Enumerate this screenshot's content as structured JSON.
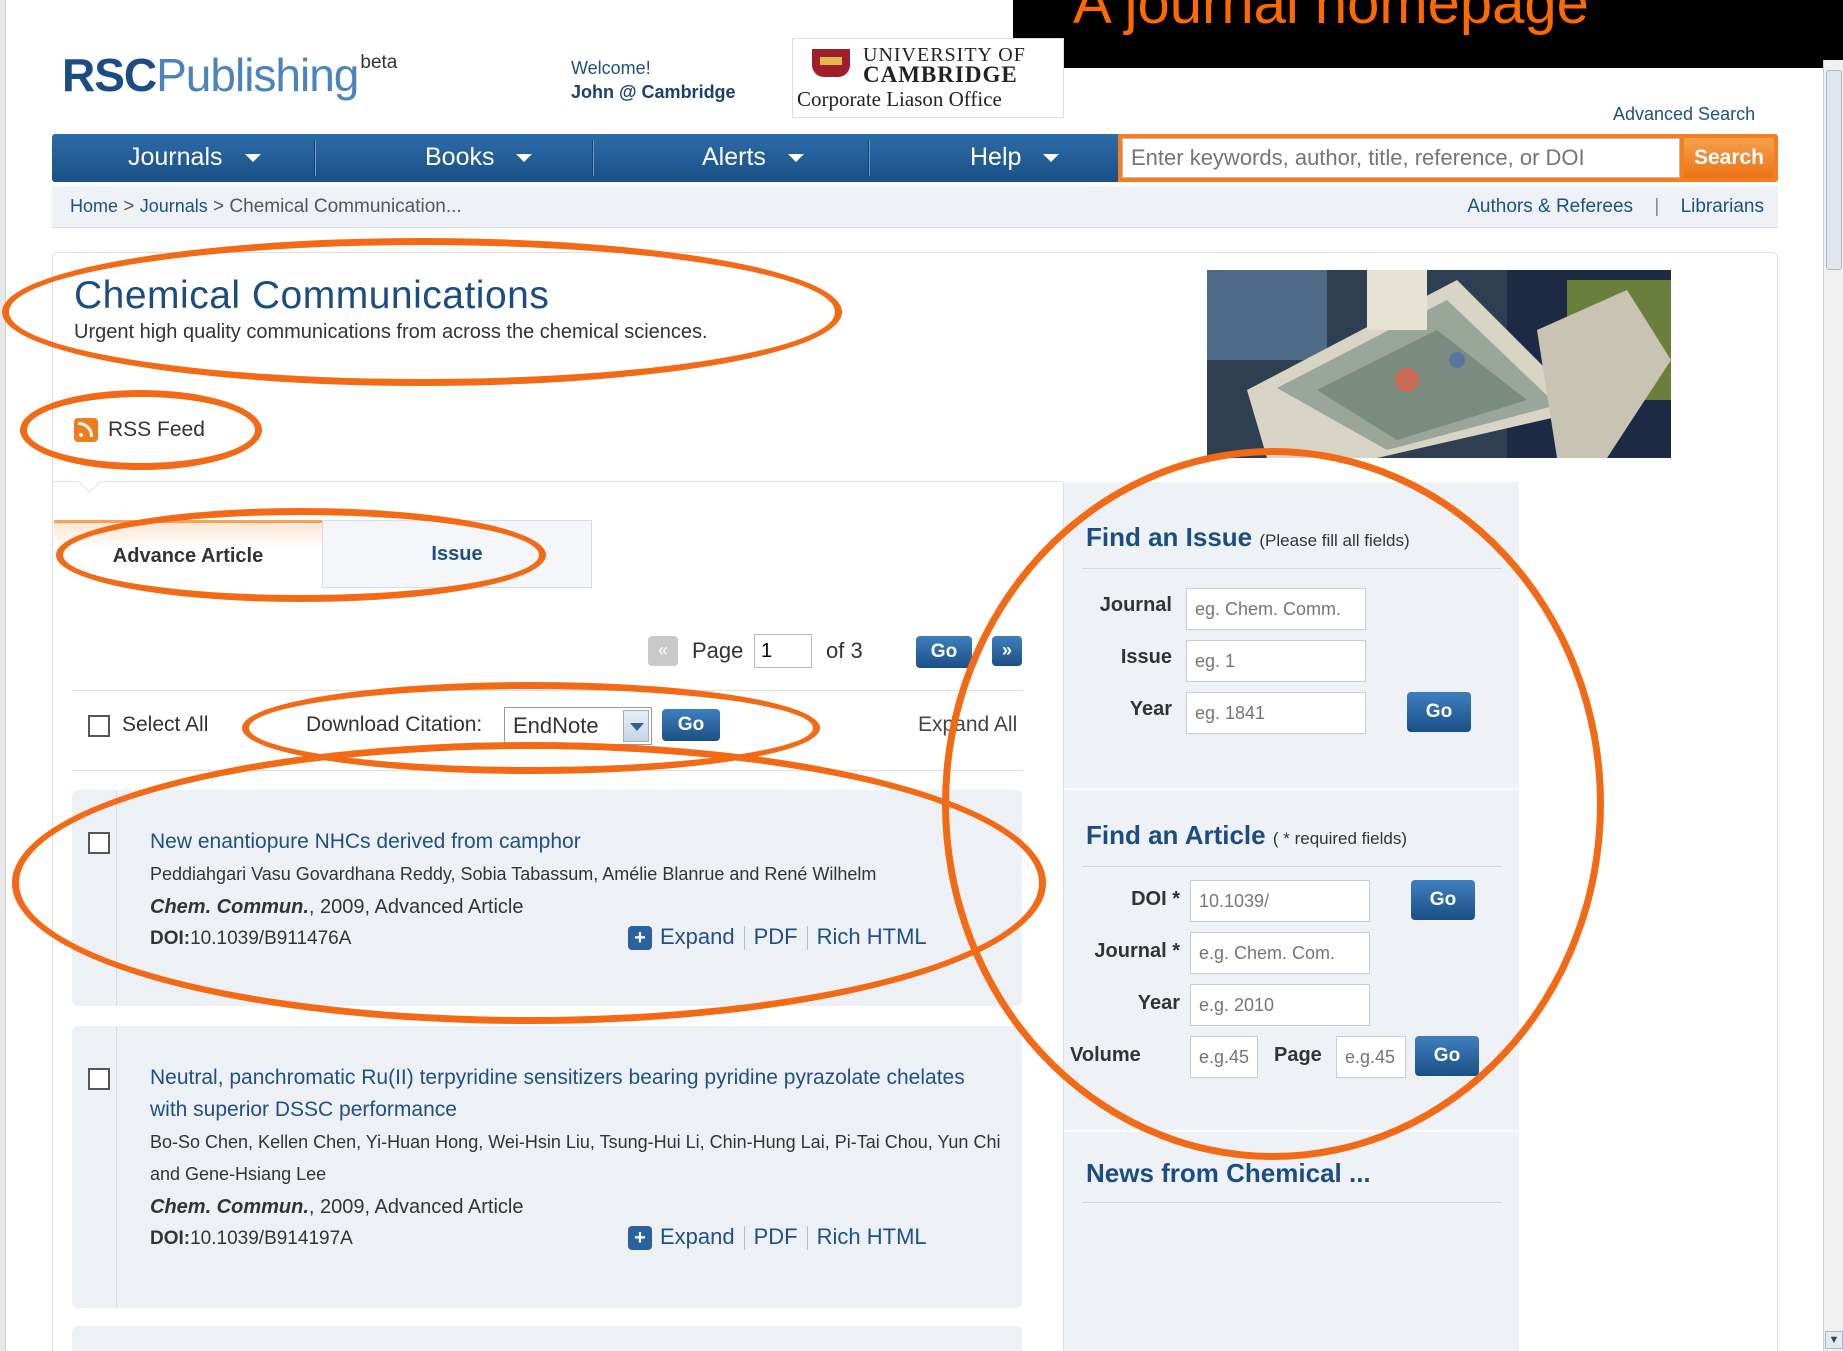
{
  "slide": {
    "title": "A journal homepage"
  },
  "header": {
    "logo_rsc": "RSC",
    "logo_publishing": "Publishing",
    "logo_beta": "beta",
    "welcome": "Welcome!",
    "user": "John @ Cambridge",
    "institution_line1": "UNIVERSITY OF",
    "institution_line2": "CAMBRIDGE",
    "institution_office": "Corporate Liason Office",
    "advanced_search": "Advanced Search"
  },
  "nav": {
    "items": [
      {
        "label": "Journals"
      },
      {
        "label": "Books"
      },
      {
        "label": "Alerts"
      },
      {
        "label": "Help"
      }
    ],
    "search_placeholder": "Enter keywords, author, title, reference, or DOI",
    "search_button": "Search"
  },
  "breadcrumb": {
    "home": "Home",
    "journals": "Journals",
    "current": "Chemical Communication...",
    "sep": ">",
    "authors_referees": "Authors & Referees",
    "separator": "|",
    "librarians": "Librarians"
  },
  "journal": {
    "title": "Chemical Communications",
    "subtitle": "Urgent high quality communications from across the chemical sciences.",
    "rss": "RSS Feed"
  },
  "tabs": {
    "advance_article": "Advance Article",
    "issue": "Issue"
  },
  "pager": {
    "prev": "«",
    "page_label": "Page",
    "page_value": "1",
    "of": "of 3",
    "go": "Go",
    "next": "»"
  },
  "toolbar": {
    "select_all": "Select All",
    "download_citation": "Download Citation:",
    "citation_format": "EndNote",
    "go": "Go",
    "expand_all": "Expand All"
  },
  "articles": [
    {
      "title": "New enantiopure NHCs derived from camphor",
      "authors": "Peddiahgari Vasu Govardhana Reddy, Sobia Tabassum, Amélie Blanrue and René Wilhelm",
      "journal": "Chem. Commun.",
      "cite_rest": ", 2009, Advanced Article",
      "doi_label": "DOI:",
      "doi": "10.1039/B911476A",
      "expand": "Expand",
      "pdf": "PDF",
      "html": "Rich HTML"
    },
    {
      "title": "Neutral, panchromatic Ru(II) terpyridine sensitizers bearing pyridine pyrazolate chelates with superior DSSC performance",
      "authors": "Bo-So Chen, Kellen Chen, Yi-Huan Hong, Wei-Hsin Liu, Tsung-Hui Li, Chin-Hung Lai, Pi-Tai Chou, Yun Chi and Gene-Hsiang Lee",
      "journal": "Chem. Commun.",
      "cite_rest": ", 2009, Advanced Article",
      "doi_label": "DOI:",
      "doi": "10.1039/B914197A",
      "expand": "Expand",
      "pdf": "PDF",
      "html": "Rich HTML"
    }
  ],
  "find_issue": {
    "heading": "Find an Issue",
    "note": "(Please fill all fields)",
    "journal_label": "Journal",
    "journal_placeholder": "eg. Chem. Comm.",
    "issue_label": "Issue",
    "issue_placeholder": "eg. 1",
    "year_label": "Year",
    "year_placeholder": "eg. 1841",
    "go": "Go"
  },
  "find_article": {
    "heading": "Find an Article",
    "note": "( * required fields)",
    "doi_label": "DOI *",
    "doi_value": "10.1039/",
    "journal_label": "Journal *",
    "journal_placeholder": "e.g. Chem. Com.",
    "year_label": "Year",
    "year_placeholder": "e.g. 2010",
    "volume_label": "Volume",
    "volume_placeholder": "e.g.45",
    "page_label": "Page",
    "page_placeholder": "e.g.45",
    "go": "Go"
  },
  "news": {
    "heading": "News from Chemical ..."
  },
  "colors": {
    "brand_blue": "#1b4d83",
    "nav_blue": "#2d6ca9",
    "search_orange": "#f57f20",
    "annotation_orange": "#f26a16"
  }
}
